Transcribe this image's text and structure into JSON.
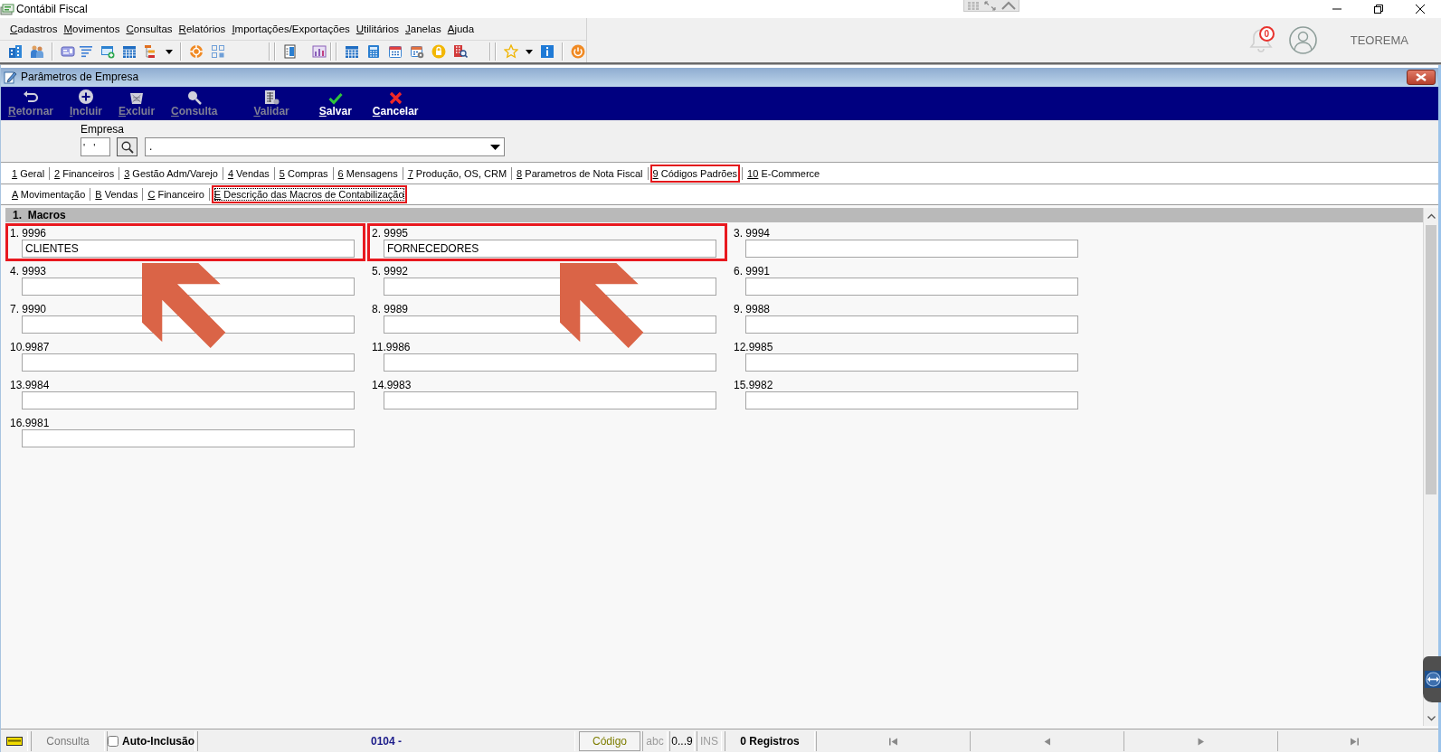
{
  "window": {
    "title": "Contábil Fiscal"
  },
  "menu": [
    {
      "label": "Cadastros"
    },
    {
      "label": "Movimentos"
    },
    {
      "label": "Consultas"
    },
    {
      "label": "Relatórios"
    },
    {
      "label": "Importações/Exportações"
    },
    {
      "label": "Utilitários"
    },
    {
      "label": "Janelas"
    },
    {
      "label": "Ajuda"
    }
  ],
  "user": {
    "name": "TEOREMA",
    "notifications": "0"
  },
  "form": {
    "title": "Parâmetros de Empresa",
    "actions": [
      {
        "kind": "return",
        "label": "Retornar",
        "disabled": true
      },
      {
        "kind": "add",
        "label": "Incluir",
        "disabled": true
      },
      {
        "kind": "delete",
        "label": "Excluir",
        "disabled": true
      },
      {
        "kind": "search",
        "label": "Consulta",
        "disabled": true
      },
      {
        "kind": "validate",
        "label": "Validar",
        "disabled": true
      },
      {
        "kind": "save",
        "label": "Salvar",
        "disabled": false
      },
      {
        "kind": "cancel",
        "label": "Cancelar",
        "disabled": false
      }
    ],
    "company": {
      "label": "Empresa",
      "code": "'   '",
      "name": "."
    },
    "tabs": [
      {
        "key": "1",
        "label": "Geral",
        "selected": false
      },
      {
        "key": "2",
        "label": "Financeiros",
        "selected": false
      },
      {
        "key": "3",
        "label": "Gestão Adm/Varejo",
        "selected": false
      },
      {
        "key": "4",
        "label": "Vendas",
        "selected": false
      },
      {
        "key": "5",
        "label": "Compras",
        "selected": false
      },
      {
        "key": "6",
        "label": "Mensagens",
        "selected": false
      },
      {
        "key": "7",
        "label": "Produção, OS, CRM",
        "selected": false
      },
      {
        "key": "8",
        "label": "Parametros de Nota Fiscal",
        "selected": false
      },
      {
        "key": "9",
        "label": "Códigos Padrões",
        "selected": true
      },
      {
        "key": "10",
        "label": "E-Commerce",
        "selected": false
      }
    ],
    "subtabs": [
      {
        "key": "A",
        "label": "Movimentação",
        "selected": false
      },
      {
        "key": "B",
        "label": "Vendas",
        "selected": false
      },
      {
        "key": "C",
        "label": "Financeiro",
        "selected": false
      },
      {
        "key": "E",
        "label": "Descrição das Macros de Contabilização",
        "selected": true
      }
    ],
    "section": {
      "title": "1.  Macros"
    },
    "macros": [
      {
        "label": "1. 9996",
        "value": "CLIENTES",
        "highlighted": true,
        "arrow": true
      },
      {
        "label": "2. 9995",
        "value": "FORNECEDORES",
        "highlighted": true,
        "arrow": true
      },
      {
        "label": "3. 9994",
        "highlighted": false,
        "arrow": false
      },
      {
        "label": "4. 9993",
        "highlighted": false,
        "arrow": false
      },
      {
        "label": "5. 9992",
        "highlighted": false,
        "arrow": false
      },
      {
        "label": "6. 9991",
        "highlighted": false,
        "arrow": false
      },
      {
        "label": "7. 9990",
        "highlighted": false,
        "arrow": false
      },
      {
        "label": "8. 9989",
        "highlighted": false,
        "arrow": false
      },
      {
        "label": "9. 9988",
        "highlighted": false,
        "arrow": false
      },
      {
        "label": "10.9987",
        "highlighted": false,
        "arrow": false
      },
      {
        "label": "11.9986",
        "highlighted": false,
        "arrow": false
      },
      {
        "label": "12.9985",
        "highlighted": false,
        "arrow": false
      },
      {
        "label": "13.9984",
        "highlighted": false,
        "arrow": false
      },
      {
        "label": "14.9983",
        "highlighted": false,
        "arrow": false
      },
      {
        "label": "15.9982",
        "highlighted": false,
        "arrow": false
      },
      {
        "label": "16.9981",
        "highlighted": false,
        "arrow": false
      }
    ]
  },
  "status_bar": {
    "mode": "Consulta",
    "auto_inclusion": {
      "label": "Auto-Inclusão",
      "checked": false
    },
    "record": "0104 -",
    "field": "Código",
    "indicators": [
      {
        "label": "abc",
        "on": false
      },
      {
        "label": "0...9",
        "on": true
      },
      {
        "label": "INS",
        "on": false
      }
    ],
    "count": "0 Registros"
  }
}
